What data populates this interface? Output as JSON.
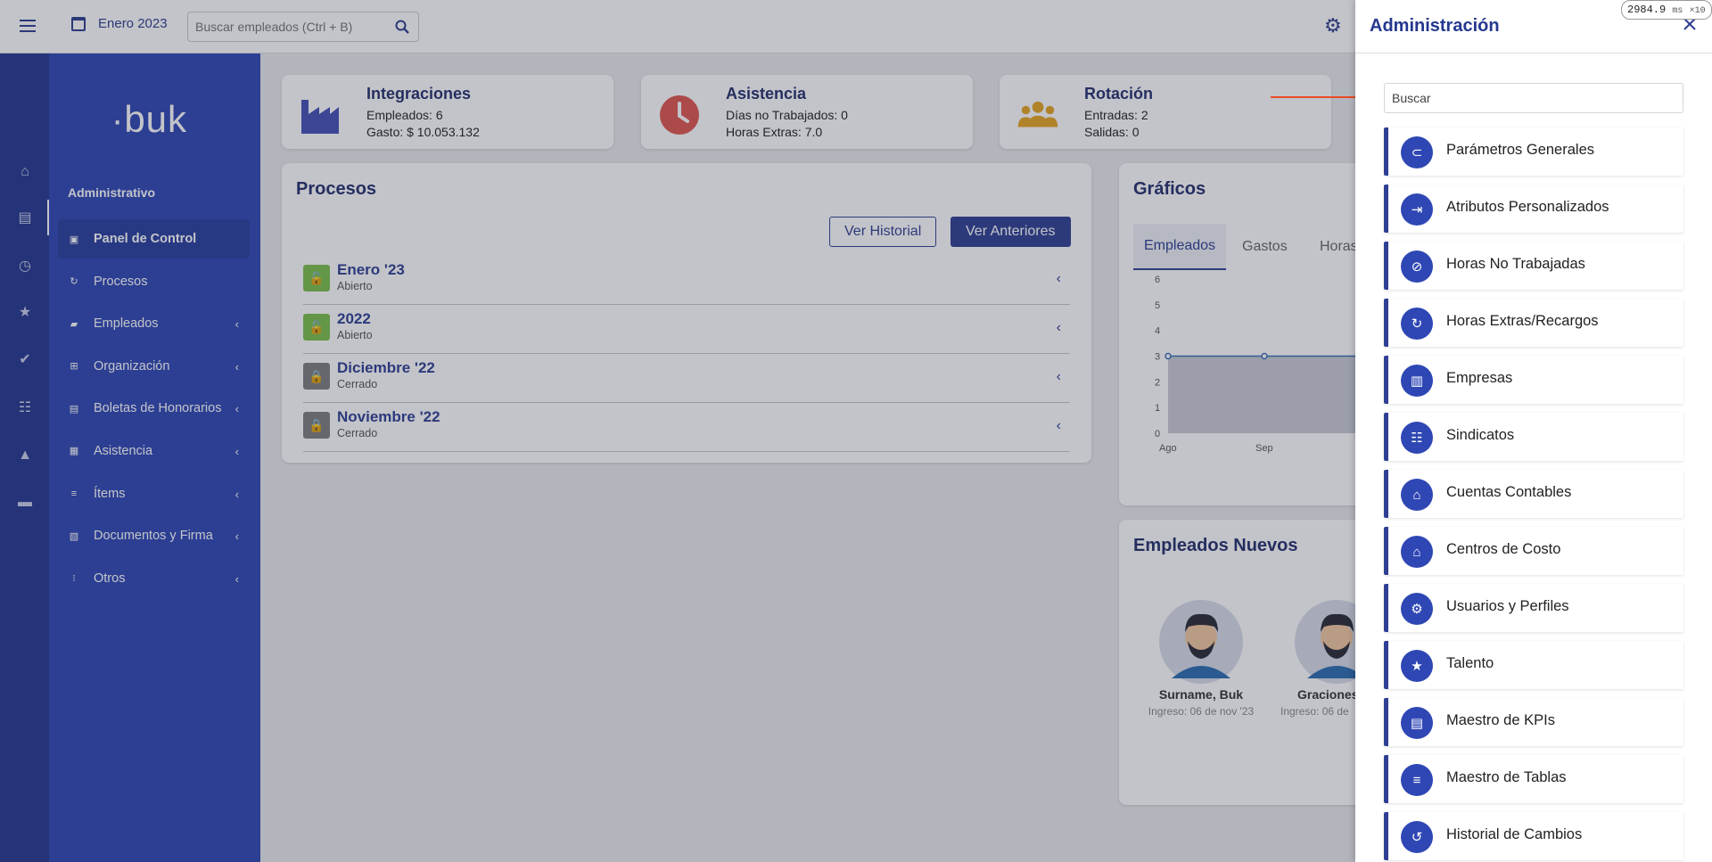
{
  "topbar": {
    "period": "Enero 2023",
    "search_placeholder": "Buscar empleados (Ctrl + B)"
  },
  "sidebar": {
    "logo": "buk",
    "heading": "Administrativo",
    "items": [
      {
        "label": "Panel de Control",
        "icon": "dashboard-icon",
        "active": true,
        "chevron": false
      },
      {
        "label": "Procesos",
        "icon": "refresh-icon",
        "chevron": false
      },
      {
        "label": "Empleados",
        "icon": "briefcase-icon",
        "chevron": true
      },
      {
        "label": "Organización",
        "icon": "org-chart-icon",
        "chevron": true
      },
      {
        "label": "Boletas de Honorarios",
        "icon": "receipt-icon",
        "chevron": true
      },
      {
        "label": "Asistencia",
        "icon": "calendar-check-icon",
        "chevron": true
      },
      {
        "label": "Ítems",
        "icon": "list-icon",
        "chevron": true
      },
      {
        "label": "Documentos y Firma",
        "icon": "documents-icon",
        "chevron": true
      },
      {
        "label": "Otros",
        "icon": "grid-icon",
        "chevron": true
      }
    ]
  },
  "stats": [
    {
      "title": "Integraciones",
      "line1": "Empleados: 6",
      "line2": "Gasto: $ 10.053.132",
      "icon": "factory-icon",
      "color": "#4451b8"
    },
    {
      "title": "Asistencia",
      "line1": "Días no Trabajados: 0",
      "line2": "Horas Extras: 7.0",
      "icon": "clock-icon",
      "color": "#e0574f"
    },
    {
      "title": "Rotación",
      "line1": "Entradas: 2",
      "line2": "Salidas: 0",
      "icon": "people-icon",
      "color": "#e5a524"
    }
  ],
  "procesos": {
    "title": "Procesos",
    "btn_historial": "Ver Historial",
    "btn_anteriores": "Ver Anteriores",
    "rows": [
      {
        "name": "Enero '23",
        "status": "Abierto",
        "open": true
      },
      {
        "name": "2022",
        "status": "Abierto",
        "open": true
      },
      {
        "name": "Diciembre '22",
        "status": "Cerrado",
        "open": false
      },
      {
        "name": "Noviembre '22",
        "status": "Cerrado",
        "open": false
      }
    ]
  },
  "graficos": {
    "title": "Gráficos",
    "tabs": [
      "Empleados",
      "Gastos",
      "Horas"
    ]
  },
  "chart_data": {
    "type": "area",
    "categories": [
      "Ago",
      "Sep"
    ],
    "series": [
      {
        "values": [
          3,
          3
        ]
      }
    ],
    "yticks": [
      "0",
      "1",
      "2",
      "3",
      "4",
      "5",
      "6"
    ],
    "ylim": [
      0,
      6
    ],
    "title": "",
    "xlabel": "",
    "ylabel": ""
  },
  "nuevos": {
    "title": "Empleados Nuevos",
    "people": [
      {
        "name": "Surname, Buk",
        "date": "Ingreso: 06 de nov '23"
      },
      {
        "name": "Graciones,",
        "date": "Ingreso: 06 de"
      }
    ]
  },
  "panel": {
    "title": "Administración",
    "search_placeholder": "Buscar",
    "items": [
      {
        "label": "Parámetros Generales",
        "icon": "toggle-icon"
      },
      {
        "label": "Atributos Personalizados",
        "icon": "input-icon"
      },
      {
        "label": "Horas No Trabajadas",
        "icon": "timer-off-icon"
      },
      {
        "label": "Horas Extras/Recargos",
        "icon": "more-time-icon"
      },
      {
        "label": "Empresas",
        "icon": "building-icon"
      },
      {
        "label": "Sindicatos",
        "icon": "groups-icon"
      },
      {
        "label": "Cuentas Contables",
        "icon": "bank-icon"
      },
      {
        "label": "Centros de Costo",
        "icon": "home-work-icon"
      },
      {
        "label": "Usuarios y Perfiles",
        "icon": "manage-accounts-icon"
      },
      {
        "label": "Talento",
        "icon": "folder-star-icon"
      },
      {
        "label": "Maestro de KPIs",
        "icon": "chart-add-icon"
      },
      {
        "label": "Maestro de Tablas",
        "icon": "playlist-add-icon"
      },
      {
        "label": "Historial de Cambios",
        "icon": "history-icon"
      }
    ]
  },
  "perf": {
    "value": "2984.9",
    "unit": "ms",
    "mult": "×10"
  },
  "colors": {
    "primary": "#2f3f94",
    "sidebar": "#2f47b4",
    "rail": "#24388f",
    "annotation": "#ea4b26"
  }
}
